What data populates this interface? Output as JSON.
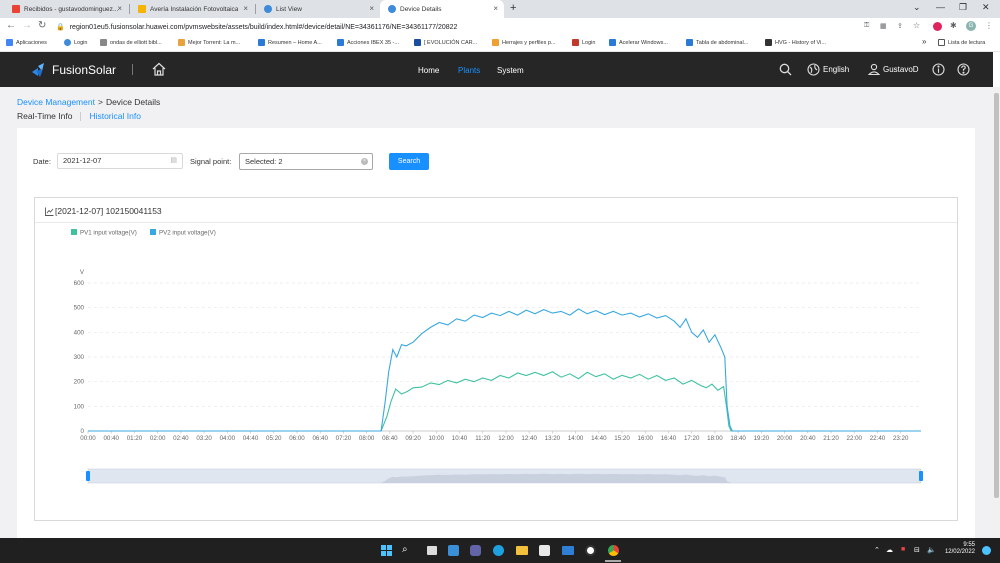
{
  "browser": {
    "tabs": [
      {
        "title": "Recibidos - gustavodominguez...",
        "icon": "gmail-icon",
        "color": "#ea4335"
      },
      {
        "title": "Avería Instalación Fotovoltaica",
        "icon": "doc-icon",
        "color": "#f4b400"
      },
      {
        "title": "List View",
        "icon": "fusionsolar-icon",
        "color": "#3d8bd9"
      },
      {
        "title": "Device Details",
        "icon": "fusionsolar-icon",
        "color": "#3d8bd9"
      }
    ],
    "new_tab": "+",
    "url": "region01eu5.fusionsolar.huawei.com/pvmswebsite/assets/build/index.html#/device/detail/NE=34361176/NE=34361177/20822",
    "bookmarks": [
      {
        "label": "Aplicaciones",
        "color": "#4285f4"
      },
      {
        "label": "Login",
        "color": "#3d8bd9"
      },
      {
        "label": "ondas de elliott bibl...",
        "color": "#888888"
      },
      {
        "label": "Mejor Torrent: La m...",
        "color": "#e8a33d"
      },
      {
        "label": "Resumen – Home A...",
        "color": "#2b7bd6"
      },
      {
        "label": "Acciones IBEX 35 -...",
        "color": "#2b7bd6"
      },
      {
        "label": "[ EVOLUCIÓN CAR...",
        "color": "#1a4fa0"
      },
      {
        "label": "Herrajes y perfiles p...",
        "color": "#f0a030"
      },
      {
        "label": "Login",
        "color": "#c0392b"
      },
      {
        "label": "Acelerar Windows...",
        "color": "#2b7bd6"
      },
      {
        "label": "Tabla de abdominal...",
        "color": "#2b7bd6"
      },
      {
        "label": "HVG - History of Vi...",
        "color": "#333333"
      }
    ],
    "bookmarks_more": "»",
    "reading_list": "Lista de lectura"
  },
  "app": {
    "logo": "FusionSolar",
    "nav": [
      {
        "label": "Home",
        "active": false
      },
      {
        "label": "Plants",
        "active": true
      },
      {
        "label": "System",
        "active": false
      }
    ],
    "language": "English",
    "user": "GustavoD"
  },
  "breadcrumb": {
    "parent": "Device Management",
    "separator": ">",
    "current": "Device Details"
  },
  "tabs": [
    {
      "label": "Real-Time Info",
      "active": false
    },
    {
      "label": "Historical Info",
      "active": true
    }
  ],
  "filters": {
    "date_label": "Date:",
    "date_value": "2021-12-07",
    "signal_label": "Signal point:",
    "signal_value": "Selected: 2",
    "search_button": "Search"
  },
  "chart_title": "[2021-12-07] 102150041153",
  "chart_data": {
    "type": "line",
    "ylabel": "V",
    "ylim": [
      0,
      600
    ],
    "yticks": [
      0,
      100,
      200,
      300,
      400,
      500,
      600
    ],
    "xticks": [
      "00:00",
      "00:40",
      "01:20",
      "02:00",
      "02:40",
      "03:20",
      "04:00",
      "04:40",
      "05:20",
      "06:00",
      "06:40",
      "07:20",
      "08:00",
      "08:40",
      "09:20",
      "10:00",
      "10:40",
      "11:20",
      "12:00",
      "12:40",
      "13:20",
      "14:00",
      "14:40",
      "15:20",
      "16:00",
      "16:40",
      "17:20",
      "18:00",
      "18:40",
      "19:20",
      "20:00",
      "20:40",
      "21:20",
      "22:00",
      "22:40",
      "23:20"
    ],
    "x_minutes_range": [
      0,
      1435
    ],
    "legend_position": "top-left",
    "series": [
      {
        "name": "PV1 input voltage(V)",
        "color": "#3fc1a0",
        "points": [
          [
            0,
            0
          ],
          [
            505,
            0
          ],
          [
            515,
            60
          ],
          [
            522,
            120
          ],
          [
            530,
            170
          ],
          [
            540,
            150
          ],
          [
            550,
            160
          ],
          [
            560,
            175
          ],
          [
            575,
            178
          ],
          [
            590,
            195
          ],
          [
            605,
            188
          ],
          [
            620,
            205
          ],
          [
            635,
            195
          ],
          [
            650,
            210
          ],
          [
            665,
            200
          ],
          [
            680,
            215
          ],
          [
            695,
            205
          ],
          [
            710,
            225
          ],
          [
            725,
            215
          ],
          [
            740,
            235
          ],
          [
            755,
            225
          ],
          [
            770,
            238
          ],
          [
            785,
            225
          ],
          [
            800,
            240
          ],
          [
            815,
            218
          ],
          [
            830,
            232
          ],
          [
            845,
            212
          ],
          [
            860,
            238
          ],
          [
            875,
            220
          ],
          [
            890,
            232
          ],
          [
            905,
            210
          ],
          [
            920,
            226
          ],
          [
            935,
            215
          ],
          [
            950,
            230
          ],
          [
            965,
            210
          ],
          [
            980,
            225
          ],
          [
            995,
            205
          ],
          [
            1010,
            215
          ],
          [
            1025,
            190
          ],
          [
            1040,
            205
          ],
          [
            1055,
            185
          ],
          [
            1065,
            175
          ],
          [
            1075,
            190
          ],
          [
            1085,
            165
          ],
          [
            1095,
            180
          ],
          [
            1100,
            100
          ],
          [
            1104,
            20
          ],
          [
            1108,
            0
          ],
          [
            1435,
            0
          ]
        ]
      },
      {
        "name": "PV2 input voltage(V)",
        "color": "#38a8e0",
        "points": [
          [
            0,
            0
          ],
          [
            505,
            0
          ],
          [
            512,
            120
          ],
          [
            518,
            240
          ],
          [
            525,
            330
          ],
          [
            532,
            300
          ],
          [
            540,
            350
          ],
          [
            548,
            345
          ],
          [
            560,
            360
          ],
          [
            575,
            395
          ],
          [
            590,
            420
          ],
          [
            605,
            440
          ],
          [
            620,
            430
          ],
          [
            635,
            455
          ],
          [
            650,
            445
          ],
          [
            665,
            470
          ],
          [
            680,
            460
          ],
          [
            695,
            478
          ],
          [
            710,
            468
          ],
          [
            725,
            485
          ],
          [
            740,
            470
          ],
          [
            755,
            490
          ],
          [
            770,
            475
          ],
          [
            785,
            492
          ],
          [
            800,
            478
          ],
          [
            815,
            485
          ],
          [
            830,
            470
          ],
          [
            845,
            495
          ],
          [
            860,
            475
          ],
          [
            875,
            488
          ],
          [
            890,
            472
          ],
          [
            905,
            485
          ],
          [
            920,
            470
          ],
          [
            935,
            478
          ],
          [
            950,
            462
          ],
          [
            965,
            475
          ],
          [
            980,
            458
          ],
          [
            995,
            468
          ],
          [
            1010,
            445
          ],
          [
            1020,
            420
          ],
          [
            1030,
            455
          ],
          [
            1040,
            400
          ],
          [
            1050,
            380
          ],
          [
            1060,
            410
          ],
          [
            1070,
            360
          ],
          [
            1080,
            390
          ],
          [
            1090,
            340
          ],
          [
            1097,
            300
          ],
          [
            1101,
            100
          ],
          [
            1106,
            20
          ],
          [
            1110,
            0
          ],
          [
            1435,
            0
          ]
        ]
      }
    ]
  },
  "taskbar": {
    "time": "9:55",
    "date": "12/02/2022"
  }
}
